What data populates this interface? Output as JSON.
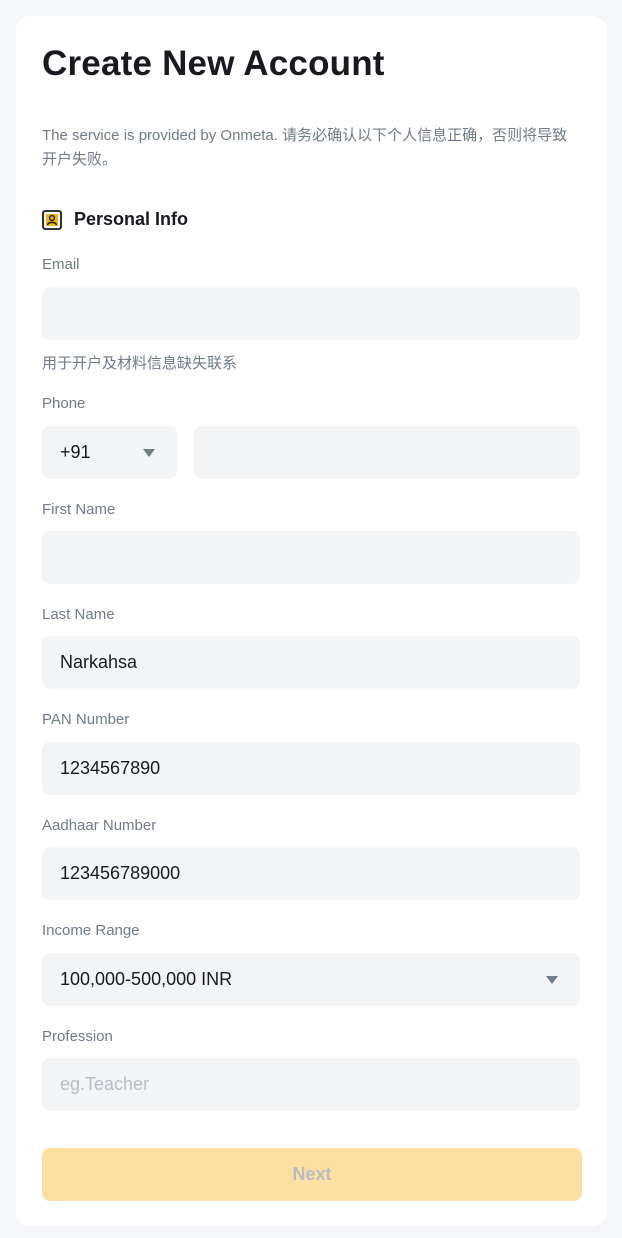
{
  "form": {
    "title": "Create New Account",
    "description": "The service is provided by Onmeta. 请务必确认以下个人信息正确，否则将导致开户失败。",
    "section_title": "Personal Info",
    "email": {
      "label": "Email",
      "value": "",
      "hint": "用于开户及材料信息缺失联系"
    },
    "phone": {
      "label": "Phone",
      "country_code": "+91",
      "value": ""
    },
    "first_name": {
      "label": "First Name",
      "value": ""
    },
    "last_name": {
      "label": "Last Name",
      "value": "Narkahsa"
    },
    "pan": {
      "label": "PAN Number",
      "value": "1234567890"
    },
    "aadhaar": {
      "label": "Aadhaar Number",
      "value": "123456789000"
    },
    "income": {
      "label": "Income Range",
      "value": "100,000-500,000 INR"
    },
    "profession": {
      "label": "Profession",
      "value": "",
      "placeholder": "eg.Teacher"
    },
    "next_label": "Next"
  },
  "icons": {
    "section": "person-card-icon",
    "dropdown": "caret-down-icon"
  },
  "colors": {
    "accent": "#f0b90b",
    "button_disabled_bg": "#fce0a2",
    "field_bg": "#f3f4f6",
    "label": "#707a8a"
  }
}
